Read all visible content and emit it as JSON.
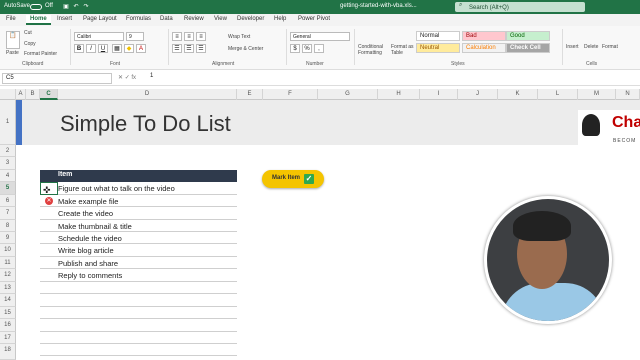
{
  "titlebar": {
    "autosave": "AutoSave",
    "toggle": "Off",
    "filename": "getting-started-with-vba.xls...",
    "search": "Search (Alt+Q)"
  },
  "tabs": [
    "File",
    "Home",
    "Insert",
    "Page Layout",
    "Formulas",
    "Data",
    "Review",
    "View",
    "Developer",
    "Help",
    "Power Pivot"
  ],
  "ribbon": {
    "groups": [
      "Clipboard",
      "Font",
      "Alignment",
      "Number",
      "Styles",
      "Cells"
    ],
    "clipboard": {
      "paste": "Paste",
      "cut": "Cut",
      "copy": "Copy",
      "format_painter": "Format Painter"
    },
    "font": {
      "name": "Calibri",
      "size": "9"
    },
    "alignment": {
      "wrap": "Wrap Text",
      "merge": "Merge & Center"
    },
    "number": {
      "format": "General"
    },
    "styles": {
      "conditional": "Conditional Formatting",
      "format_as_table": "Format as Table",
      "normal": "Normal",
      "bad": "Bad",
      "good": "Good",
      "neutral": "Neutral",
      "calculation": "Calculation",
      "check_cell": "Check Cell"
    },
    "cells": {
      "insert": "Insert",
      "delete": "Delete",
      "format": "Format"
    }
  },
  "formula_bar": {
    "name_box": "C5",
    "value": "1"
  },
  "columns": [
    "A",
    "B",
    "C",
    "D",
    "E",
    "F",
    "G",
    "H",
    "I",
    "J",
    "K",
    "L",
    "M",
    "N"
  ],
  "rows": [
    "1",
    "2",
    "3",
    "4",
    "5",
    "6",
    "7",
    "8",
    "9",
    "10",
    "11",
    "12",
    "13",
    "14",
    "15",
    "16",
    "17",
    "18"
  ],
  "sheet": {
    "title": "Simple To Do List",
    "header": "Item",
    "items": [
      "Figure out what to talk on the video",
      "Make example file",
      "Create the video",
      "Make thumbnail & title",
      "Schedule the video",
      "Write blog article",
      "Publish and share",
      "Reply to comments"
    ],
    "mark_button": "Mark Item",
    "logo_text": "Cha",
    "logo_sub": "BECOM"
  },
  "colors": {
    "excel_green": "#217346",
    "header_dark": "#2f3a4c",
    "button_yellow": "#f4c400",
    "accent_blue": "#4472c4"
  }
}
